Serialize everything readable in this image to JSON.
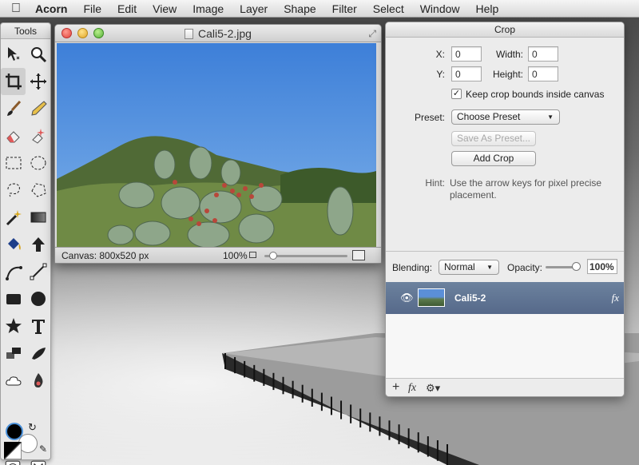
{
  "menubar": {
    "apple": "",
    "app_name": "Acorn",
    "items": [
      "File",
      "Edit",
      "View",
      "Image",
      "Layer",
      "Shape",
      "Filter",
      "Select",
      "Window",
      "Help"
    ]
  },
  "tools": {
    "title": "Tools",
    "items": [
      {
        "name": "move-tool-icon",
        "selected": false
      },
      {
        "name": "zoom-tool-icon",
        "selected": false
      },
      {
        "name": "crop-tool-icon",
        "selected": true
      },
      {
        "name": "pan-tool-icon",
        "selected": false
      },
      {
        "name": "brush-tool-icon",
        "selected": false
      },
      {
        "name": "pencil-tool-icon",
        "selected": false
      },
      {
        "name": "eraser-tool-icon",
        "selected": false
      },
      {
        "name": "magic-eraser-tool-icon",
        "selected": false
      },
      {
        "name": "rect-select-tool-icon",
        "selected": false
      },
      {
        "name": "ellipse-select-tool-icon",
        "selected": false
      },
      {
        "name": "lasso-tool-icon",
        "selected": false
      },
      {
        "name": "polygon-lasso-tool-icon",
        "selected": false
      },
      {
        "name": "magic-wand-tool-icon",
        "selected": false
      },
      {
        "name": "gradient-tool-icon",
        "selected": false
      },
      {
        "name": "paint-bucket-tool-icon",
        "selected": false
      },
      {
        "name": "arrow-shape-tool-icon",
        "selected": false
      },
      {
        "name": "bezier-pen-tool-icon",
        "selected": false
      },
      {
        "name": "line-tool-icon",
        "selected": false
      },
      {
        "name": "rectangle-shape-tool-icon",
        "selected": false
      },
      {
        "name": "oval-shape-tool-icon",
        "selected": false
      },
      {
        "name": "star-shape-tool-icon",
        "selected": false
      },
      {
        "name": "text-tool-icon",
        "selected": false
      },
      {
        "name": "clone-tool-icon",
        "selected": false
      },
      {
        "name": "smudge-tool-icon",
        "selected": false
      },
      {
        "name": "cloud-tool-icon",
        "selected": false
      },
      {
        "name": "burn-tool-icon",
        "selected": false
      }
    ],
    "colors": {
      "foreground": "#000000",
      "background": "#ffffff"
    }
  },
  "document": {
    "title": "Cali5-2.jpg",
    "canvas_size": "Canvas: 800x520 px",
    "zoom": "100%",
    "zoom_slider_fraction": 0.06
  },
  "crop": {
    "title": "Crop",
    "x_label": "X:",
    "x_value": "0",
    "y_label": "Y:",
    "y_value": "0",
    "width_label": "Width:",
    "width_value": "0",
    "height_label": "Height:",
    "height_value": "0",
    "keep_bounds_label": "Keep crop bounds inside canvas",
    "keep_bounds_checked": true,
    "preset_label": "Preset:",
    "preset_value": "Choose Preset",
    "save_preset_label": "Save As Preset...",
    "add_crop_label": "Add Crop",
    "hint_label": "Hint:",
    "hint_text": "Use the arrow keys for pixel precise placement."
  },
  "layers": {
    "blending_label": "Blending:",
    "blending_value": "Normal",
    "opacity_label": "Opacity:",
    "opacity_value": "100%",
    "layer_name": "Cali5-2",
    "fx_label": "fx",
    "footer_add": "+",
    "footer_fx": "fx",
    "footer_gear": "⚙▾"
  }
}
